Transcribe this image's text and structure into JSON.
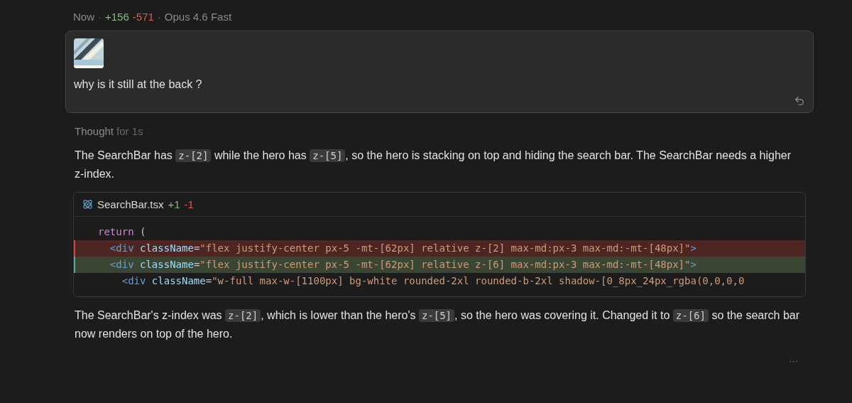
{
  "header": {
    "time": "Now",
    "separator_1": "·",
    "additions": "+156",
    "deletions": "-571",
    "separator_2": "·",
    "model": "Opus 4.6 Fast"
  },
  "user_message": {
    "text": "why is it still at the back ?"
  },
  "thought": {
    "label": "Thought",
    "duration": "for 1s"
  },
  "paragraphs_before": [
    [
      {
        "kind": "text",
        "text": "The SearchBar has "
      },
      {
        "kind": "code",
        "text": "z-[2]"
      },
      {
        "kind": "text",
        "text": " while the hero has "
      },
      {
        "kind": "code",
        "text": "z-[5]"
      },
      {
        "kind": "text",
        "text": ", so the hero is stacking on top and hiding the search bar. The SearchBar needs a higher z-index."
      }
    ]
  ],
  "file_diff": {
    "filename": "SearchBar.tsx",
    "additions": "+1",
    "deletions": "-1",
    "lines": [
      {
        "kind": "context",
        "tokens": [
          {
            "kind": "keyword",
            "text": "return"
          },
          {
            "kind": "punct",
            "text": " ("
          }
        ]
      },
      {
        "kind": "removed",
        "tokens": [
          {
            "kind": "tag",
            "text": "  <div"
          },
          {
            "kind": "attr",
            "text": " className"
          },
          {
            "kind": "punct",
            "text": "="
          },
          {
            "kind": "string",
            "text": "\"flex justify-center px-5 -mt-[62px] relative z-[2] max-md:px-3 max-md:-mt-[48px]\""
          },
          {
            "kind": "tag",
            "text": ">"
          }
        ]
      },
      {
        "kind": "added",
        "tokens": [
          {
            "kind": "tag",
            "text": "  <div"
          },
          {
            "kind": "attr",
            "text": " className"
          },
          {
            "kind": "punct",
            "text": "="
          },
          {
            "kind": "string",
            "text": "\"flex justify-center px-5 -mt-[62px] relative z-[6] max-md:px-3 max-md:-mt-[48px]\""
          },
          {
            "kind": "tag",
            "text": ">"
          }
        ]
      },
      {
        "kind": "context",
        "tokens": [
          {
            "kind": "tag",
            "text": "    <div"
          },
          {
            "kind": "attr",
            "text": " className"
          },
          {
            "kind": "punct",
            "text": "="
          },
          {
            "kind": "string",
            "text": "\"w-full max-w-[1100px] bg-white rounded-2xl rounded-b-2xl shadow-[0_8px_24px_rgba(0,0,0,0"
          }
        ]
      }
    ]
  },
  "paragraphs_after": [
    [
      {
        "kind": "text",
        "text": "The SearchBar's z-index was "
      },
      {
        "kind": "code",
        "text": "z-[2]"
      },
      {
        "kind": "text",
        "text": ", which is lower than the hero's "
      },
      {
        "kind": "code",
        "text": "z-[5]"
      },
      {
        "kind": "text",
        "text": ", so the hero was covering it. Changed it to "
      },
      {
        "kind": "code",
        "text": "z-[6]"
      },
      {
        "kind": "text",
        "text": " so the search bar now renders on top of the hero."
      }
    ]
  ],
  "more_button": "···"
}
